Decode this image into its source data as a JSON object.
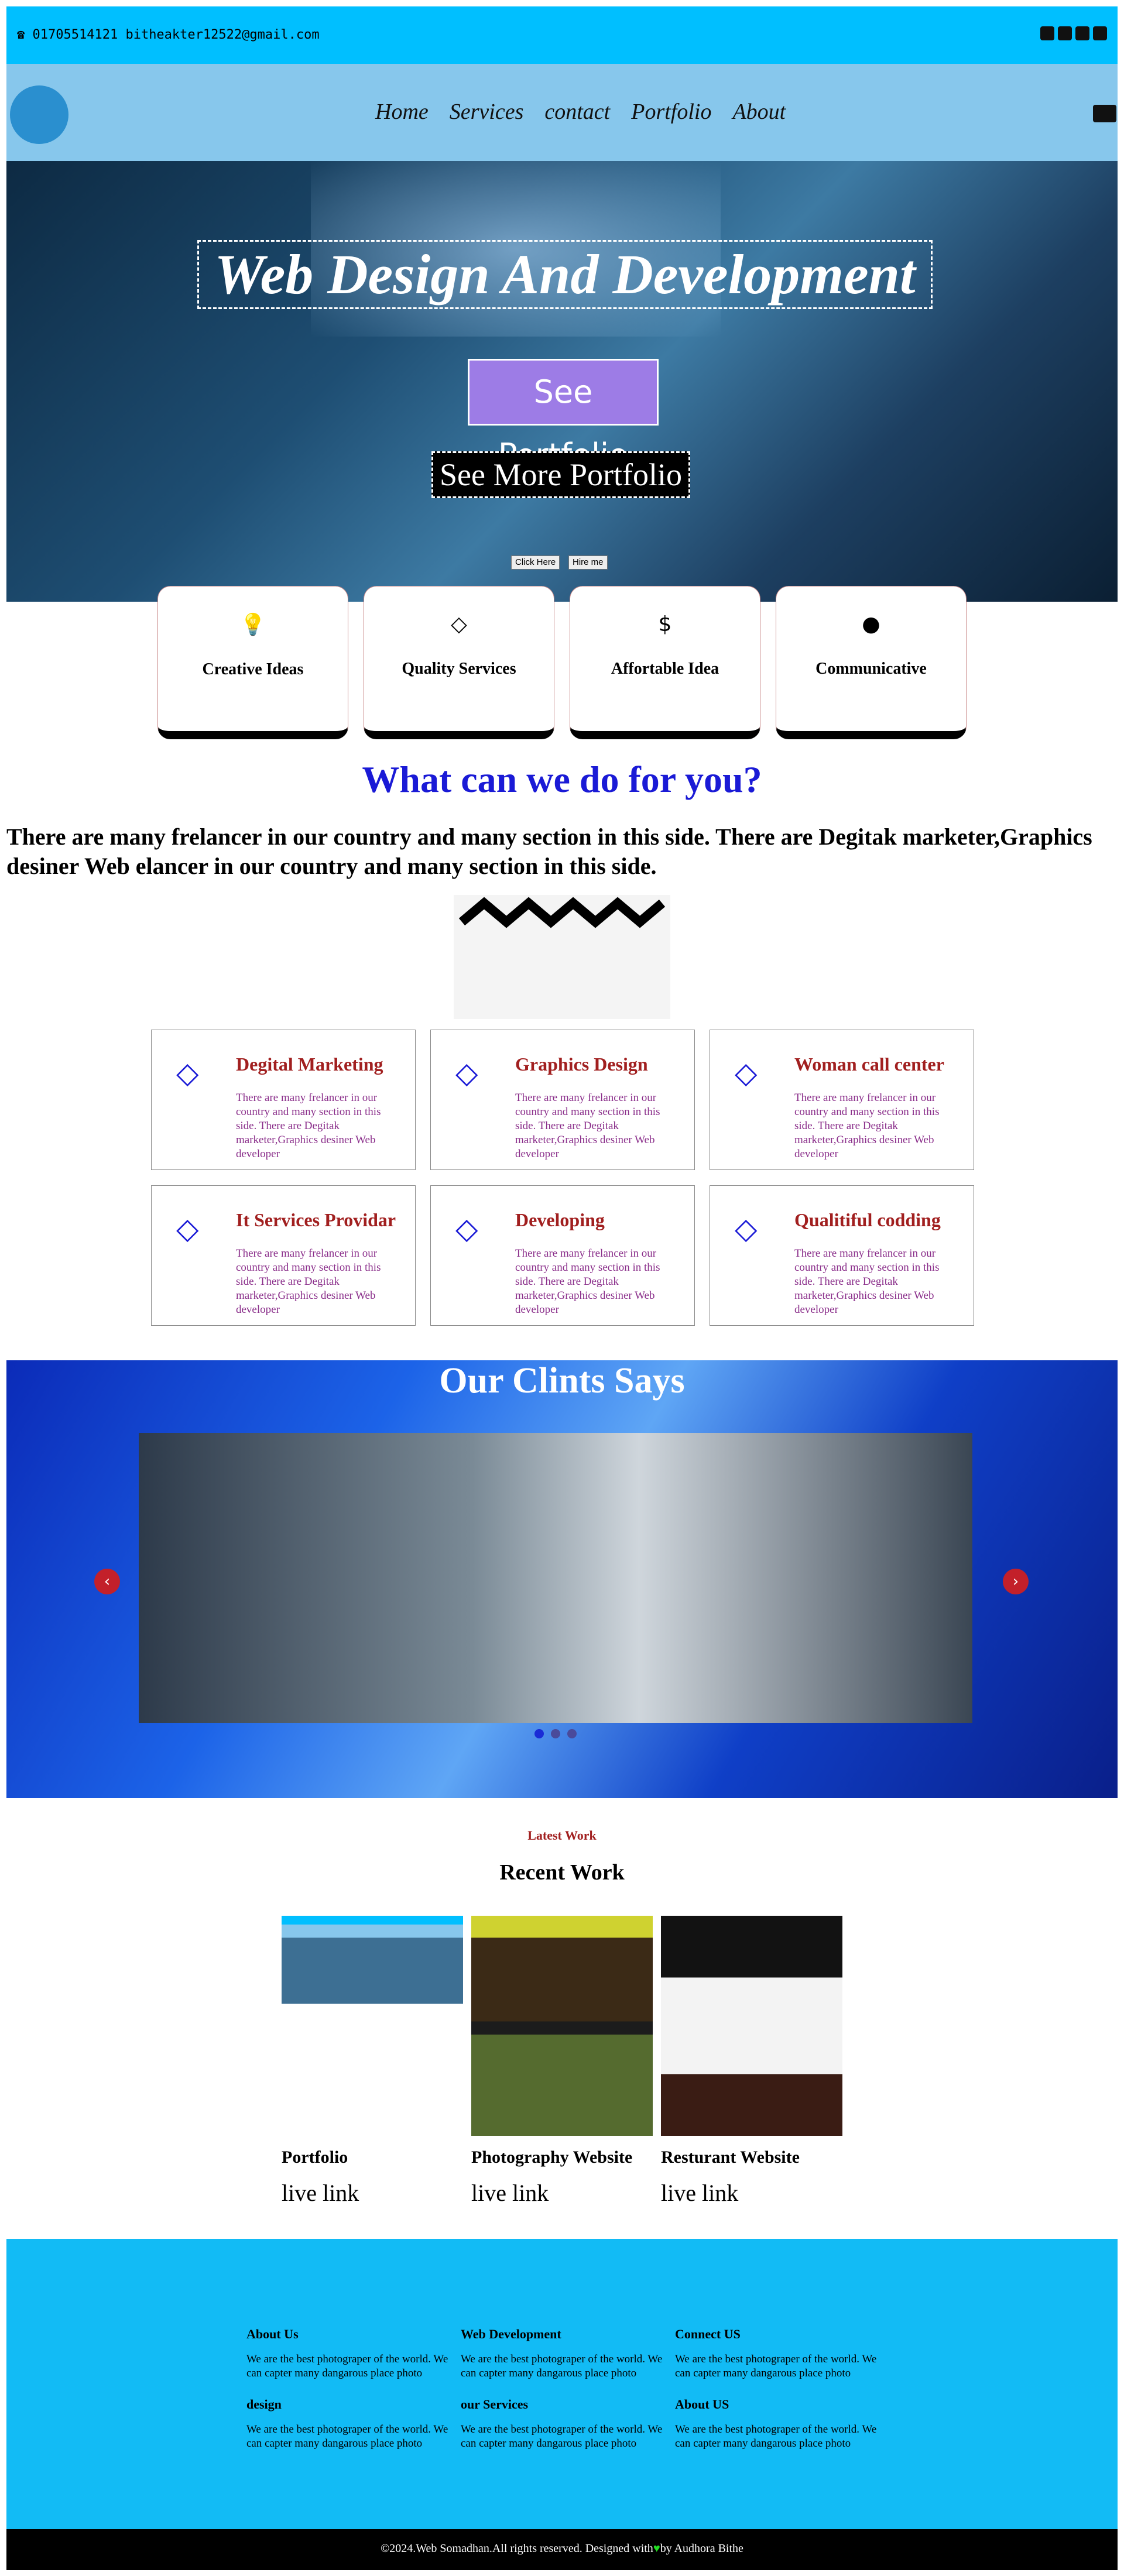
{
  "topbar": {
    "phone": "01705514121",
    "email": "bitheakter12522@gmail.com",
    "socials": [
      "mail-icon",
      "linkedin-icon",
      "instagram-icon",
      "facebook-icon"
    ]
  },
  "nav": {
    "items": [
      "Home",
      "Services",
      "contact",
      "Portfolio",
      "About"
    ]
  },
  "hero": {
    "title": "Web Design And Development",
    "button_primary": "See Portfolio",
    "button_secondary": "See More Portfolio",
    "small_buttons": [
      "Click Here",
      "Hire me"
    ]
  },
  "features": [
    {
      "icon": "lightbulb-icon",
      "glyph": "💡",
      "title": "Creative Ideas"
    },
    {
      "icon": "diamond-icon",
      "glyph": "◇",
      "title": "Quality Services"
    },
    {
      "icon": "dollar-icon",
      "glyph": "$",
      "title": "Affortable Idea"
    },
    {
      "icon": "globe-icon",
      "glyph": "●",
      "title": "Communicative"
    }
  ],
  "section": {
    "title": "What can we do for you?",
    "intro": "There are many frelancer in our country and many section in this side. There are Degitak marketer,Graphics desiner Web elancer in our country and many section in this side."
  },
  "services": [
    {
      "title": "Degital Marketing",
      "desc": "There are many frelancer in our country and many section in this side. There are Degitak marketer,Graphics desiner Web developer"
    },
    {
      "title": "Graphics Design",
      "desc": "There are many frelancer in our country and many section in this side. There are Degitak marketer,Graphics desiner Web developer"
    },
    {
      "title": "Woman call center",
      "desc": "There are many frelancer in our country and many section in this side. There are Degitak marketer,Graphics desiner Web developer"
    },
    {
      "title": "It Services Providar",
      "desc": "There are many frelancer in our country and many section in this side. There are Degitak marketer,Graphics desiner Web developer"
    },
    {
      "title": "Developing",
      "desc": "There are many frelancer in our country and many section in this side. There are Degitak marketer,Graphics desiner Web developer"
    },
    {
      "title": "Qualitiful codding",
      "desc": "There are many frelancer in our country and many section in this side. There are Degitak marketer,Graphics desiner Web developer"
    }
  ],
  "clients": {
    "title": "Our Clints Says"
  },
  "work": {
    "eyebrow": "Latest Work",
    "title": "Recent Work",
    "items": [
      {
        "title": "Portfolio",
        "link": "live link"
      },
      {
        "title": "Photography Website",
        "link": "live link"
      },
      {
        "title": "Resturant Website",
        "link": "live link"
      }
    ]
  },
  "footer": {
    "columns": [
      {
        "heading": "About Us",
        "text": "We are the best photograper of the world. We can capter many dangarous place photo"
      },
      {
        "heading": "Web Development",
        "text": "We are the best photograper of the world. We can capter many dangarous place photo"
      },
      {
        "heading": "Connect US",
        "text": "We are the best photograper of the world. We can capter many dangarous place photo"
      },
      {
        "heading": "design",
        "text": "We are the best photograper of the world. We can capter many dangarous place photo"
      },
      {
        "heading": "our Services",
        "text": "We are the best photograper of the world. We can capter many dangarous place photo"
      },
      {
        "heading": "About US",
        "text": "We are the best photograper of the world. We can capter many dangarous place photo"
      }
    ],
    "copyright_pre": "©2024.Web Somadhan.All rights reserved. Designed with",
    "copyright_post": "by Audhora Bithe"
  }
}
